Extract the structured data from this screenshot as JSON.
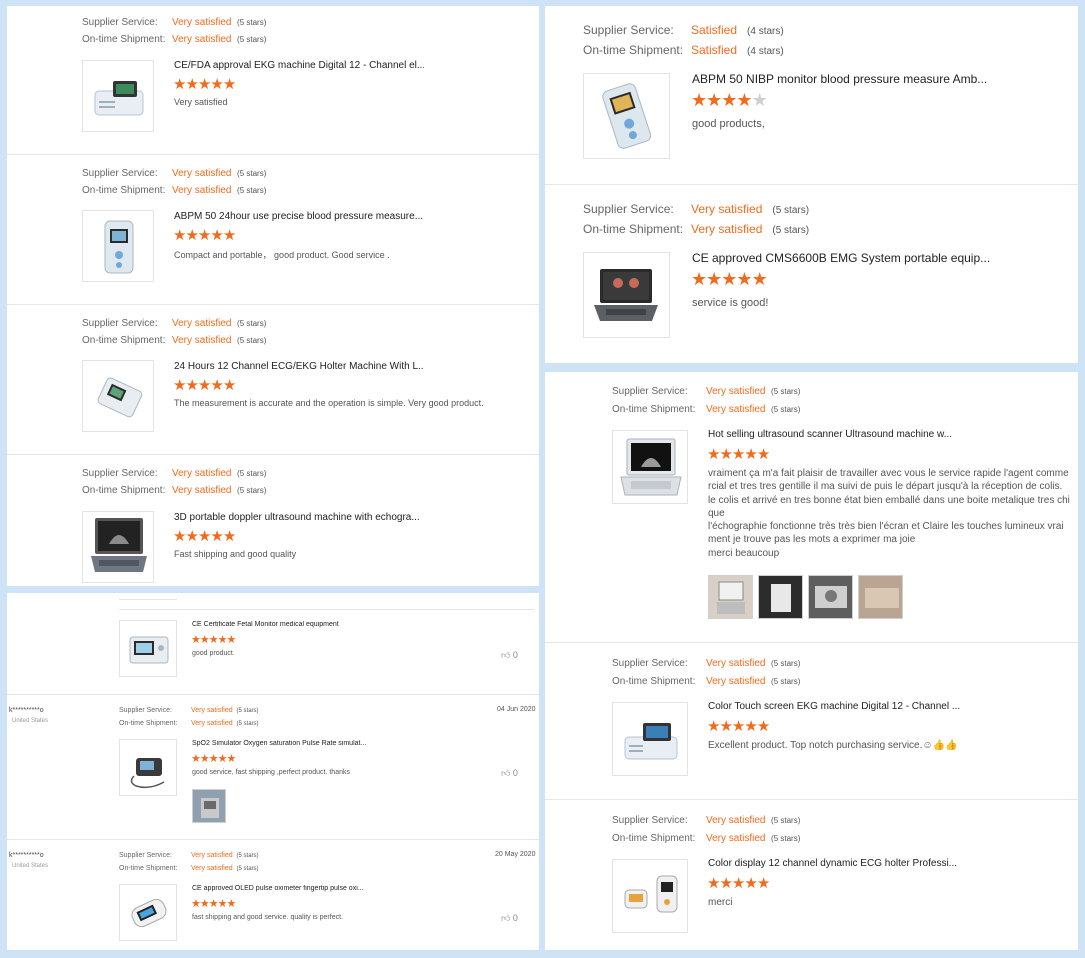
{
  "labels": {
    "supplier_service": "Supplier Service:",
    "ontime_shipment": "On-time Shipment:"
  },
  "colors": {
    "accent": "#f26b1d",
    "background": "#cfe3f6"
  },
  "panels": {
    "top_left": {
      "reviews": [
        {
          "supplier_value": "Very satisfied",
          "supplier_stars": "(5 stars)",
          "shipment_value": "Very satisfied",
          "shipment_stars": "(5 stars)",
          "product_title": "CE/FDA approval EKG machine Digital 12 - Channel el...",
          "rating": 5,
          "comment": "Very satisfied",
          "icon": "ekg-machine-icon"
        },
        {
          "supplier_value": "Very satisfied",
          "supplier_stars": "(5 stars)",
          "shipment_value": "Very satisfied",
          "shipment_stars": "(5 stars)",
          "product_title": "ABPM 50 24hour use precise blood pressure measure...",
          "rating": 5,
          "comment": "Compact and portable， good product. Good service .",
          "icon": "bp-monitor-icon"
        },
        {
          "supplier_value": "Very satisfied",
          "supplier_stars": "(5 stars)",
          "shipment_value": "Very satisfied",
          "shipment_stars": "(5 stars)",
          "product_title": "24 Hours 12 Channel ECG/EKG Holter Machine With L...",
          "rating": 5,
          "comment": "The measurement is accurate and the operation is simple. Very good product.",
          "icon": "holter-icon"
        },
        {
          "supplier_value": "Very satisfied",
          "supplier_stars": "(5 stars)",
          "shipment_value": "Very satisfied",
          "shipment_stars": "(5 stars)",
          "product_title": "3D portable doppler ultrasound machine with echogra...",
          "rating": 5,
          "comment": "Fast shipping and good quality",
          "icon": "laptop-ultrasound-icon"
        }
      ]
    },
    "top_right": {
      "reviews": [
        {
          "supplier_value": "Satisfied",
          "supplier_stars": "(4 stars)",
          "shipment_value": "Satisfied",
          "shipment_stars": "(4 stars)",
          "product_title": "ABPM 50 NIBP monitor blood pressure measure Amb...",
          "rating": 4,
          "comment": "good products,",
          "icon": "bp-monitor-icon"
        },
        {
          "supplier_value": "Very satisfied",
          "supplier_stars": "(5 stars)",
          "shipment_value": "Very satisfied",
          "shipment_stars": "(5 stars)",
          "product_title": "CE approved CMS6600B EMG System portable equip...",
          "rating": 5,
          "comment": "service is good!",
          "icon": "emg-laptop-icon"
        }
      ]
    },
    "bottom_left": {
      "reviews": [
        {
          "product_title": "CE Certificate Fetal Monitor medical equipment",
          "rating": 5,
          "comment": "good product.",
          "likes": "0",
          "icon": "fetal-monitor-icon"
        },
        {
          "user": "k**********o",
          "country": "United States",
          "date": "04 Jun 2020",
          "supplier_value": "Very satisfied",
          "supplier_stars": "(5 stars)",
          "shipment_value": "Very satisfied",
          "shipment_stars": "(5 stars)",
          "product_title": "SpO2 Simulator Oxygen saturation Pulse Rate simulat...",
          "rating": 5,
          "comment": "good service, fast shipping ,perfect product. thanks",
          "likes": "0",
          "icon": "spo2-simulator-icon"
        },
        {
          "user": "k**********o",
          "country": "United States",
          "date": "20 May 2020",
          "supplier_value": "Very satisfied",
          "supplier_stars": "(5 stars)",
          "shipment_value": "Very satisfied",
          "shipment_stars": "(5 stars)",
          "product_title": "CE approved OLED pulse oximeter fingertip pulse oxi...",
          "rating": 5,
          "comment": "fast shipping and good service. quality is perfect.",
          "likes": "0",
          "icon": "pulse-oximeter-icon"
        }
      ]
    },
    "bottom_right": {
      "reviews": [
        {
          "supplier_value": "Very satisfied",
          "supplier_stars": "(5 stars)",
          "shipment_value": "Very satisfied",
          "shipment_stars": "(5 stars)",
          "product_title": "Hot selling ultrasound scanner Ultrasound machine w...",
          "rating": 5,
          "comment_lines": [
            "vraiment ça m'a fait plaisir de travailler avec vous  le service rapide l'agent comme",
            "rcial et tres tres gentille il ma suivi de puis le départ jusqu'à la réception de colis.",
            "le colis et arrivé en tres bonne état bien emballé dans une boite metalique tres chi",
            "que",
            "l'échographie fonctionne très très bien l'écran et Claire  les touches  lumineux vrai",
            "ment je trouve pas les mots a exprimer ma joie",
            "merci beaucoup"
          ],
          "icon": "ultrasound-scanner-icon"
        },
        {
          "supplier_value": "Very satisfied",
          "supplier_stars": "(5 stars)",
          "shipment_value": "Very satisfied",
          "shipment_stars": "(5 stars)",
          "product_title": "Color Touch screen EKG machine Digital 12 - Channel ...",
          "rating": 5,
          "comment": "Excellent product. Top notch purchasing service.☺👍👍",
          "icon": "ekg-machine-icon"
        },
        {
          "supplier_value": "Very satisfied",
          "supplier_stars": "(5 stars)",
          "shipment_value": "Very satisfied",
          "shipment_stars": "(5 stars)",
          "product_title": "Color display 12 channel dynamic ECG holter Professi...",
          "rating": 5,
          "comment": "merci",
          "icon": "ecg-holter-icon"
        }
      ]
    }
  }
}
